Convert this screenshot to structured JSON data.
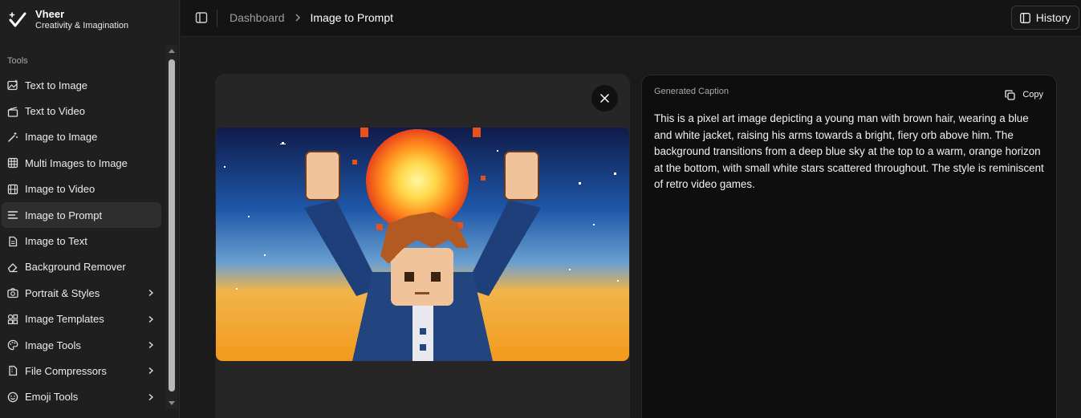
{
  "brand": {
    "name": "Vheer",
    "tagline": "Creativity & Imagination"
  },
  "sidebar": {
    "section_label": "Tools",
    "items": [
      {
        "label": "Text to Image",
        "icon": "image-sparkle-icon",
        "active": false,
        "chevron": false
      },
      {
        "label": "Text to Video",
        "icon": "clapperboard-icon",
        "active": false,
        "chevron": false
      },
      {
        "label": "Image to Image",
        "icon": "magic-wand-icon",
        "active": false,
        "chevron": false
      },
      {
        "label": "Multi Images to Image",
        "icon": "grid-icon",
        "active": false,
        "chevron": false
      },
      {
        "label": "Image to Video",
        "icon": "film-icon",
        "active": false,
        "chevron": false
      },
      {
        "label": "Image to Prompt",
        "icon": "text-lines-icon",
        "active": true,
        "chevron": false
      },
      {
        "label": "Image to Text",
        "icon": "document-icon",
        "active": false,
        "chevron": false
      },
      {
        "label": "Background Remover",
        "icon": "eraser-icon",
        "active": false,
        "chevron": false
      },
      {
        "label": "Portrait & Styles",
        "icon": "camera-icon",
        "active": false,
        "chevron": true
      },
      {
        "label": "Image Templates",
        "icon": "shapes-icon",
        "active": false,
        "chevron": true
      },
      {
        "label": "Image Tools",
        "icon": "palette-icon",
        "active": false,
        "chevron": true
      },
      {
        "label": "File Compressors",
        "icon": "file-zip-icon",
        "active": false,
        "chevron": true
      },
      {
        "label": "Emoji Tools",
        "icon": "smiley-icon",
        "active": false,
        "chevron": true
      }
    ]
  },
  "header": {
    "breadcrumb": [
      "Dashboard",
      "Image to Prompt"
    ],
    "history_label": "History"
  },
  "preview": {
    "alt": "Pixel art: young man with brown hair in blue and white jacket raising arms toward a fiery orb"
  },
  "caption": {
    "label": "Generated Caption",
    "copy_label": "Copy",
    "text": "This is a pixel art image depicting a young man with brown hair, wearing a blue and white jacket, raising his arms towards a bright, fiery orb above him. The background transitions from a deep blue sky at the top to a warm, orange horizon at the bottom, with small white stars scattered throughout. The style is reminiscent of retro video games."
  },
  "colors": {
    "sidebar_bg": "#1f1f1f",
    "header_bg": "#141414",
    "main_bg": "#1b1b1b",
    "caption_bg": "#0e0e0e",
    "active_item_bg": "#2e2e2e"
  }
}
